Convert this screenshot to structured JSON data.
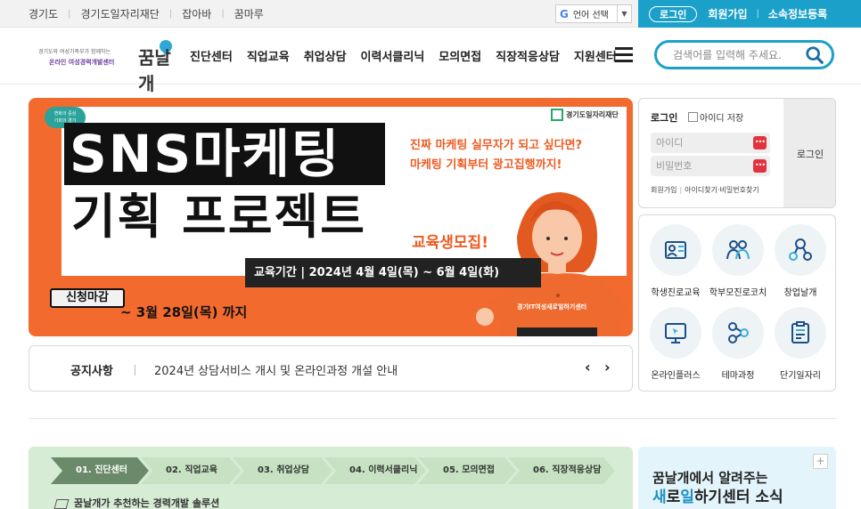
{
  "topbar": {
    "links": [
      "경기도",
      "경기도일자리재단",
      "잡아바",
      "꿈마루"
    ],
    "language": "언어 선택",
    "login": "로그인",
    "join": "회원가입",
    "family": "소속정보등록"
  },
  "header": {
    "logo_tagline": "경기도와 여성가족부가 함께하는",
    "logo_org": "온라인 여성경력개발센터",
    "logo_brand": "꿈날개",
    "menu": [
      "진단센터",
      "직업교육",
      "취업상담",
      "이력서클리닉",
      "모의면접",
      "직장적응상담",
      "지원센터"
    ],
    "search_placeholder": "검색어를 입력해 주세요."
  },
  "banner": {
    "pill": [
      "변화의 중심",
      "기회의 경기"
    ],
    "foundation": "경기도일자리재단",
    "title1": "SNS마케팅",
    "title2": "기획 프로젝트",
    "hook1": "진짜 마케팅 실무자가 되고 싶다면?",
    "hook2": "마케팅 기획부터 광고집행까지!",
    "recruit": "교육생모집!",
    "period": "교육기간  |  2024년 4월 4일(목) ~ 6월 4일(화)",
    "closing": "신청마감",
    "deadline": "~ 3월 28일(목) 까지",
    "org": "경기IT여성새로일하기센터"
  },
  "notice": {
    "label": "공지사항",
    "text": "2024년 상담서비스 개시 및 온라인과정 개설 안내"
  },
  "login": {
    "title": "로그인",
    "save_id": "아이디 저장",
    "id_placeholder": "아이디",
    "pw_placeholder": "비밀번호",
    "join": "회원가입",
    "find": "아이디찾기·비밀번호찾기",
    "button": "로그인"
  },
  "quick": [
    {
      "label": "학생진로교육",
      "icon": "student-icon"
    },
    {
      "label": "학부모진로코치",
      "icon": "parents-icon"
    },
    {
      "label": "창업날개",
      "icon": "startup-icon"
    },
    {
      "label": "온라인플러스",
      "icon": "monitor-icon"
    },
    {
      "label": "테마과정",
      "icon": "network-icon"
    },
    {
      "label": "단기일자리",
      "icon": "clipboard-icon"
    }
  ],
  "steps": {
    "items": [
      "01. 진단센터",
      "02. 직업교육",
      "03. 취업상담",
      "04. 이력서클리닉",
      "05. 모의면접",
      "06. 직장적응상담"
    ],
    "active": 0,
    "subtitle": "꿈날개가 추천하는 경력개발 솔루션"
  },
  "news": {
    "line1": "꿈날개에서 알려주는",
    "line2_pre": "새로",
    "line2_hl": "일",
    "line2_post": "하기센터 소식",
    "line2_pre_hl": "새",
    "line2_mid": "로"
  },
  "colors": {
    "accent": "#1ba1c9",
    "banner": "#f26a2e",
    "step_active": "#6a8a6a"
  }
}
